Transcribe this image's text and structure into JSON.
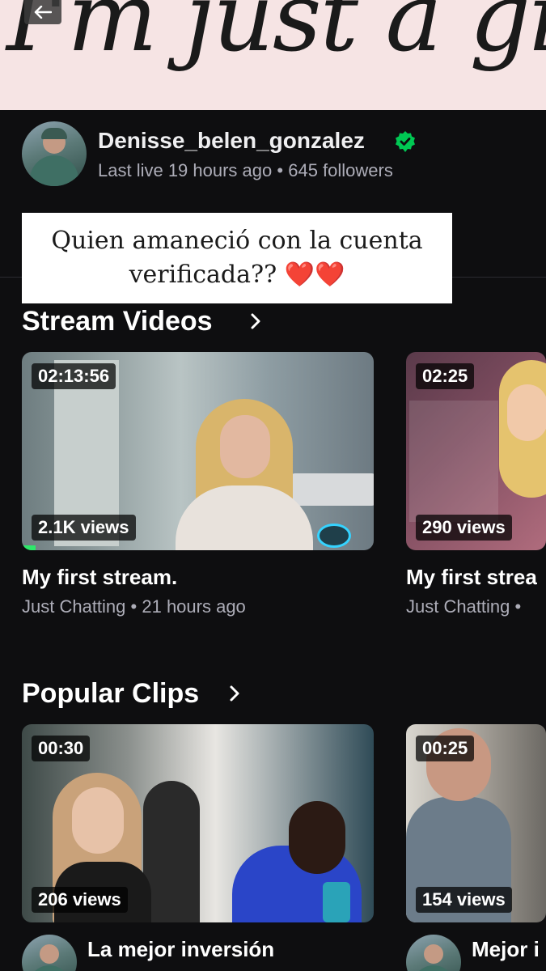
{
  "banner": {
    "text": "I'm just a girl"
  },
  "channel": {
    "name": "Denisse_belen_gonzalez",
    "last_live": "Last live 19 hours ago",
    "separator": "•",
    "followers": "645 followers"
  },
  "sticker": {
    "text": "Quien amaneció con la cuenta verificada?? ❤️❤️"
  },
  "stream_videos": {
    "title": "Stream Videos",
    "items": [
      {
        "duration": "02:13:56",
        "views": "2.1K views",
        "title": "My first stream.",
        "category": "Just Chatting",
        "age": "21 hours ago",
        "progress": 0.04
      },
      {
        "duration": "02:25",
        "views": "290 views",
        "title": "My first strea",
        "category": "Just Chatting",
        "age": ""
      }
    ]
  },
  "popular_clips": {
    "title": "Popular Clips",
    "items": [
      {
        "duration": "00:30",
        "views": "206 views",
        "title": "La mejor inversión"
      },
      {
        "duration": "00:25",
        "views": "154 views",
        "title": "Mejor i"
      }
    ]
  },
  "colors": {
    "background": "#0e0e10",
    "verified": "#00c853",
    "progress": "#2ee86a",
    "meta": "#adadb8"
  },
  "icons": [
    "back-arrow-icon",
    "verified-badge-icon",
    "chevron-right-icon"
  ]
}
